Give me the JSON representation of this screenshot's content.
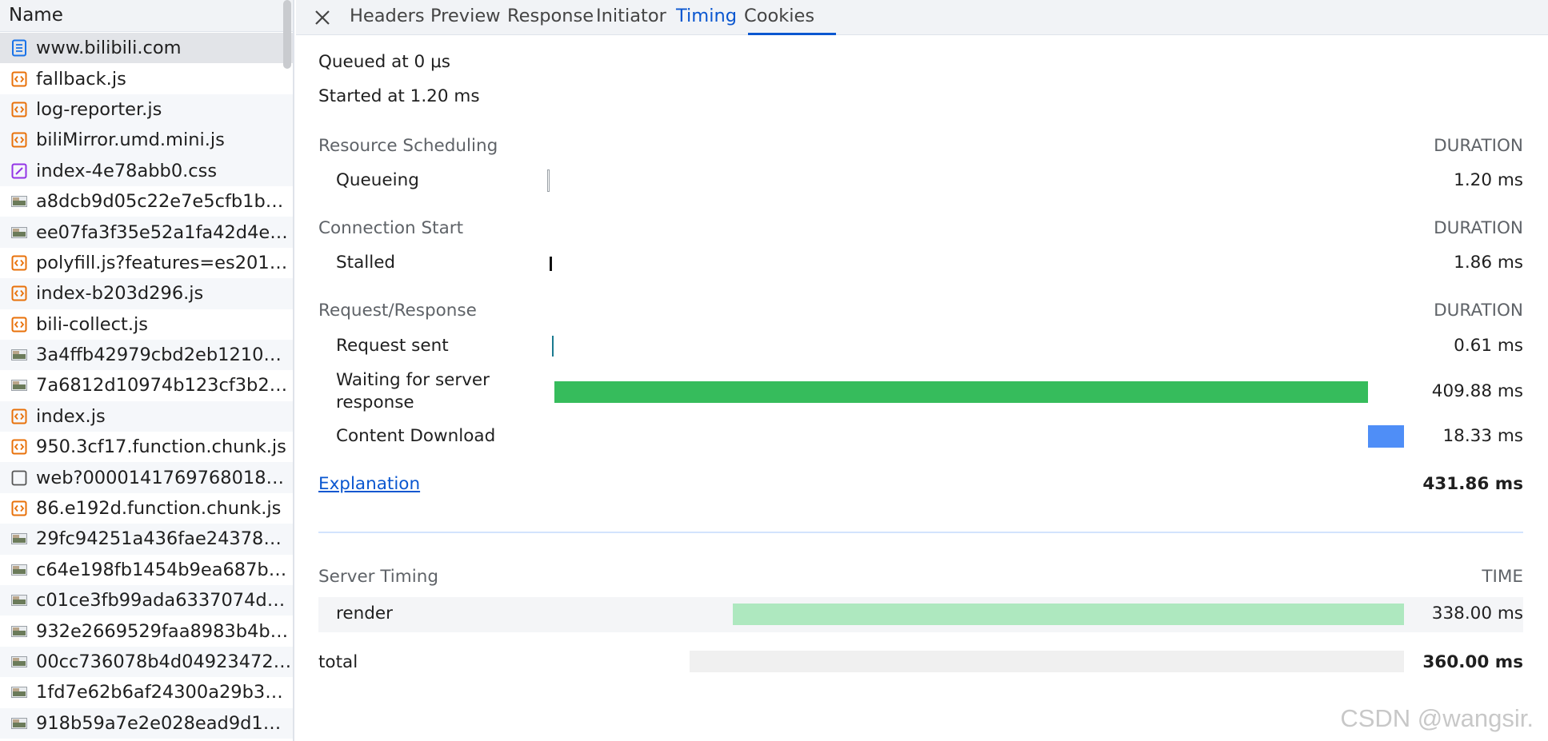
{
  "request_list": {
    "header": "Name",
    "items": [
      {
        "name": "www.bilibili.com",
        "icon": "document-icon"
      },
      {
        "name": "fallback.js",
        "icon": "script-icon"
      },
      {
        "name": "log-reporter.js",
        "icon": "script-icon"
      },
      {
        "name": "biliMirror.umd.mini.js",
        "icon": "script-icon"
      },
      {
        "name": "index-4e78abb0.css",
        "icon": "stylesheet-icon"
      },
      {
        "name": "a8dcb9d05c22e7e5cfb1bbd…",
        "icon": "image-thumbnail-icon"
      },
      {
        "name": "ee07fa3f35e52a1fa42d4e34…",
        "icon": "image-thumbnail-icon"
      },
      {
        "name": "polyfill.js?features=es2015%…",
        "icon": "script-icon"
      },
      {
        "name": "index-b203d296.js",
        "icon": "script-icon"
      },
      {
        "name": "bili-collect.js",
        "icon": "script-icon"
      },
      {
        "name": "3a4ffb42979cbd2eb1210b7…",
        "icon": "image-thumbnail-icon"
      },
      {
        "name": "7a6812d10974b123cf3b23b…",
        "icon": "image-thumbnail-icon"
      },
      {
        "name": "index.js",
        "icon": "script-icon"
      },
      {
        "name": "950.3cf17.function.chunk.js",
        "icon": "script-icon"
      },
      {
        "name": "web?000014176976801825…",
        "icon": "other-icon"
      },
      {
        "name": "86.e192d.function.chunk.js",
        "icon": "script-icon"
      },
      {
        "name": "29fc94251a436fae24378ec3…",
        "icon": "image-thumbnail-icon"
      },
      {
        "name": "c64e198fb1454b9ea687b17…",
        "icon": "image-thumbnail-icon"
      },
      {
        "name": "c01ce3fb99ada6337074da2…",
        "icon": "image-thumbnail-icon"
      },
      {
        "name": "932e2669529faa8983b4b80…",
        "icon": "image-thumbnail-icon"
      },
      {
        "name": "00cc736078b4d049234721f…",
        "icon": "image-thumbnail-icon"
      },
      {
        "name": "1fd7e62b6af24300a29b3b9…",
        "icon": "image-thumbnail-icon"
      },
      {
        "name": "918b59a7e2e028ead9d1668…",
        "icon": "image-thumbnail-icon"
      }
    ]
  },
  "tabs": {
    "close_icon": "close-icon",
    "items": [
      "Headers",
      "Preview",
      "Response",
      "Initiator",
      "Timing",
      "Cookies"
    ],
    "active": "Timing"
  },
  "timing": {
    "queued_at": "Queued at 0 μs",
    "started_at": "Started at 1.20 ms",
    "duration_label": "DURATION",
    "sections": {
      "resource_scheduling": "Resource Scheduling",
      "connection_start": "Connection Start",
      "request_response": "Request/Response"
    },
    "phases": {
      "queueing": {
        "label": "Queueing",
        "value": "1.20 ms"
      },
      "stalled": {
        "label": "Stalled",
        "value": "1.86 ms"
      },
      "request_sent": {
        "label": "Request sent",
        "value": "0.61 ms"
      },
      "waiting": {
        "label": "Waiting for server response",
        "label_line1": "Waiting for server",
        "label_line2": "response",
        "value": "409.88 ms"
      },
      "content_download": {
        "label": "Content Download",
        "value": "18.33 ms"
      }
    },
    "explanation_link": "Explanation",
    "total": "431.86 ms"
  },
  "server_timing": {
    "title": "Server Timing",
    "time_label": "TIME",
    "render": {
      "label": "render",
      "value": "338.00 ms"
    },
    "total": {
      "label": "total",
      "value": "360.00 ms"
    }
  },
  "colors": {
    "accent": "#0b57d0",
    "waiting_bar": "#36bc5c",
    "download_bar": "#4f8ef7",
    "request_sent_bar": "#1a7a8f",
    "render_bar": "#aee8bf",
    "total_bar": "#f0f0f0"
  },
  "watermark": "CSDN @wangsir."
}
